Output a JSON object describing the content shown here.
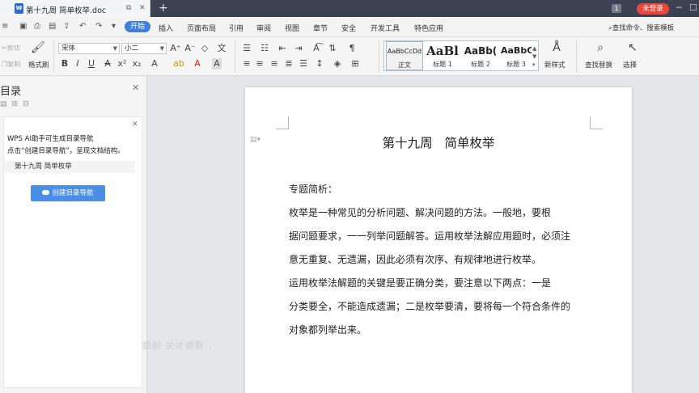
{
  "titlebar": {
    "doc_title": "第十九周  简单枚举.doc",
    "new_tab": "+",
    "badge": "1",
    "login": "未登录",
    "icons": [
      "wps-writer-icon",
      "restore-icon",
      "close-icon",
      "minimize-icon",
      "maximize-icon"
    ]
  },
  "menu": {
    "items": [
      "开始",
      "插入",
      "页面布局",
      "引用",
      "审阅",
      "视图",
      "章节",
      "安全",
      "开发工具",
      "特色应用"
    ],
    "search": "查找命令、搜索模板"
  },
  "ribbon": {
    "cut": "剪切",
    "copy": "复制",
    "format_painter": "格式刷",
    "font_name": "宋体",
    "font_size": "小二",
    "styles": [
      {
        "sample": "AaBbCcDd",
        "name": "正文"
      },
      {
        "sample": "AaBl",
        "name": "标题 1"
      },
      {
        "sample": "AaBb(",
        "name": "标题 2"
      },
      {
        "sample": "AaBbC",
        "name": "标题 3"
      }
    ],
    "new_style": "新样式",
    "find_replace": "查找替换",
    "select": "选择"
  },
  "navpane": {
    "title": "目录",
    "ai_line1": "WPS AI助手可生成目录导航",
    "ai_line2": "点击“创建目录导航”，呈现文档结构。",
    "toc_entry": "第十九周   简单枚举",
    "create_button": "创建目录导航"
  },
  "watermark": "提制   关才要数  .",
  "document": {
    "title": "第十九周   简单枚举",
    "lines": [
      "专题简析：",
      "    枚举是一种常见的分析问题、解决问题的方法。一般地，要根",
      "据问题要求，一一列举问题解答。运用枚举法解应用题时，必须注",
      "意无重复、无遗漏，因此必须有次序、有规律地进行枚举。",
      "    运用枚举法解题的关键是要正确分类，要注意以下两点：一是",
      "分类要全，不能造成遗漏；二是枚举要清，要将每一个符合条件的",
      "对象都列举出来。"
    ]
  },
  "colors": {
    "titlebar_bg": "#3c4251",
    "accent_blue": "#4080d8",
    "login_red": "#e8473b",
    "nav_button": "#4a8ee6"
  }
}
